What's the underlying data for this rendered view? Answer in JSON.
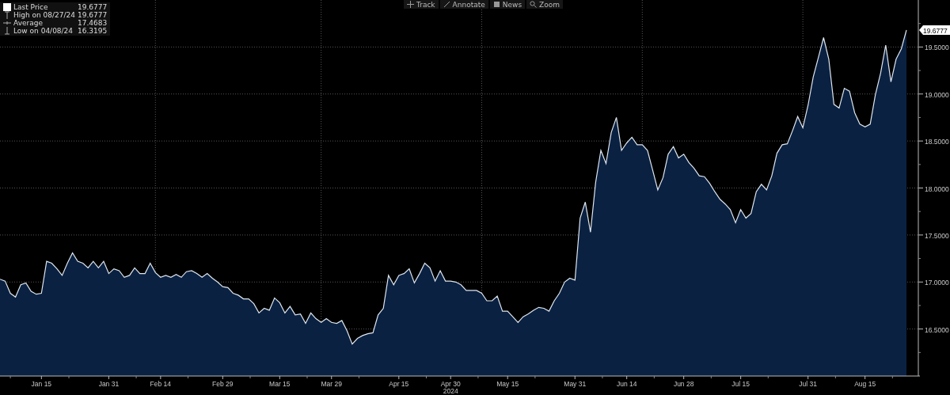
{
  "toolbar": [
    {
      "kind": "track",
      "label": "Track"
    },
    {
      "kind": "annotate",
      "label": "Annotate"
    },
    {
      "kind": "news",
      "label": "News"
    },
    {
      "kind": "zoom",
      "label": "Zoom"
    }
  ],
  "legend": [
    {
      "kind": "last",
      "value": "19.6777"
    },
    {
      "kind": "high",
      "label": "High on 08/27/24",
      "value": "19.6777"
    },
    {
      "kind": "average",
      "label": "Average",
      "value": "17.4683"
    },
    {
      "kind": "low",
      "label": "Low on 04/08/24",
      "value": "16.3195"
    }
  ],
  "last_price_tag": "19.6777",
  "chart_data": {
    "type": "area",
    "xlabel": "2024",
    "grid": true,
    "ylim": [
      16.0,
      20.0
    ],
    "categories": [
      null,
      null,
      null,
      null,
      null,
      null,
      null,
      null,
      "Jan 15",
      null,
      null,
      null,
      null,
      null,
      null,
      null,
      null,
      null,
      null,
      null,
      null,
      "Jan 31",
      null,
      null,
      null,
      null,
      null,
      null,
      null,
      null,
      null,
      "Feb 14",
      null,
      null,
      null,
      null,
      null,
      null,
      null,
      null,
      null,
      null,
      null,
      "Feb 29",
      null,
      null,
      null,
      null,
      null,
      null,
      null,
      null,
      null,
      null,
      "Mar 15",
      null,
      null,
      null,
      null,
      null,
      null,
      null,
      null,
      null,
      "Mar 29",
      null,
      null,
      null,
      null,
      null,
      null,
      null,
      null,
      null,
      null,
      null,
      null,
      "Apr 15",
      null,
      null,
      null,
      null,
      null,
      null,
      null,
      null,
      null,
      "Apr 30",
      null,
      null,
      null,
      null,
      null,
      null,
      null,
      null,
      null,
      null,
      "May 15",
      null,
      null,
      null,
      null,
      null,
      null,
      null,
      null,
      null,
      null,
      null,
      null,
      "May 31",
      null,
      null,
      null,
      null,
      null,
      null,
      null,
      null,
      null,
      "Jun 14",
      null,
      null,
      null,
      null,
      null,
      null,
      null,
      null,
      null,
      null,
      "Jun 28",
      null,
      null,
      null,
      null,
      null,
      null,
      null,
      null,
      null,
      null,
      "Jul 15",
      null,
      null,
      null,
      null,
      null,
      null,
      null,
      null,
      null,
      null,
      null,
      null,
      "Jul 31",
      null,
      null,
      null,
      null,
      null,
      null,
      null,
      null,
      null,
      null,
      "Aug 15",
      null,
      null,
      null,
      null,
      null,
      null,
      null,
      null
    ],
    "yticks": [
      {
        "value": 16.5,
        "label": "16.5000"
      },
      {
        "value": 17.0,
        "label": "17.0000"
      },
      {
        "value": 17.5,
        "label": "17.5000"
      },
      {
        "value": 18.0,
        "label": "18.0000"
      },
      {
        "value": 18.5,
        "label": "18.5000"
      },
      {
        "value": 19.0,
        "label": "19.0000"
      },
      {
        "value": 19.5,
        "label": "19.5000"
      }
    ],
    "series": [
      {
        "name": "Last Price",
        "color": "#dfe6ee",
        "values": [
          17.03,
          17.01,
          16.88,
          16.84,
          16.97,
          16.99,
          16.9,
          16.87,
          16.88,
          17.22,
          17.2,
          17.14,
          17.07,
          17.2,
          17.31,
          17.22,
          17.2,
          17.15,
          17.22,
          17.15,
          17.22,
          17.09,
          17.14,
          17.12,
          17.05,
          17.07,
          17.15,
          17.09,
          17.09,
          17.2,
          17.1,
          17.05,
          17.07,
          17.05,
          17.08,
          17.05,
          17.11,
          17.12,
          17.09,
          17.05,
          17.09,
          17.04,
          17.0,
          16.95,
          16.94,
          16.88,
          16.86,
          16.82,
          16.82,
          16.77,
          16.67,
          16.72,
          16.7,
          16.83,
          16.78,
          16.67,
          16.74,
          16.65,
          16.66,
          16.56,
          16.67,
          16.61,
          16.57,
          16.61,
          16.57,
          16.56,
          16.59,
          16.48,
          16.34,
          16.4,
          16.43,
          16.45,
          16.46,
          16.65,
          16.72,
          17.07,
          16.97,
          17.07,
          17.09,
          17.14,
          16.99,
          17.09,
          17.2,
          17.15,
          17.01,
          17.12,
          17.01,
          17.01,
          17.0,
          16.97,
          16.91,
          16.91,
          16.91,
          16.88,
          16.8,
          16.8,
          16.85,
          16.69,
          16.69,
          16.63,
          16.57,
          16.63,
          16.66,
          16.7,
          16.73,
          16.72,
          16.69,
          16.8,
          16.88,
          17.0,
          17.04,
          17.02,
          17.68,
          17.85,
          17.53,
          18.06,
          18.4,
          18.26,
          18.59,
          18.75,
          18.4,
          18.48,
          18.54,
          18.46,
          18.46,
          18.4,
          18.19,
          17.98,
          18.11,
          18.36,
          18.44,
          18.32,
          18.36,
          18.27,
          18.21,
          18.13,
          18.12,
          18.05,
          17.96,
          17.88,
          17.83,
          17.77,
          17.63,
          17.77,
          17.68,
          17.73,
          17.96,
          18.04,
          17.98,
          18.13,
          18.37,
          18.46,
          18.47,
          18.61,
          18.76,
          18.64,
          18.88,
          19.18,
          19.39,
          19.6,
          19.37,
          18.89,
          18.85,
          19.06,
          19.03,
          18.8,
          18.68,
          18.65,
          18.68,
          18.99,
          19.22,
          19.52,
          19.13,
          19.37,
          19.48,
          19.68
        ]
      }
    ]
  }
}
